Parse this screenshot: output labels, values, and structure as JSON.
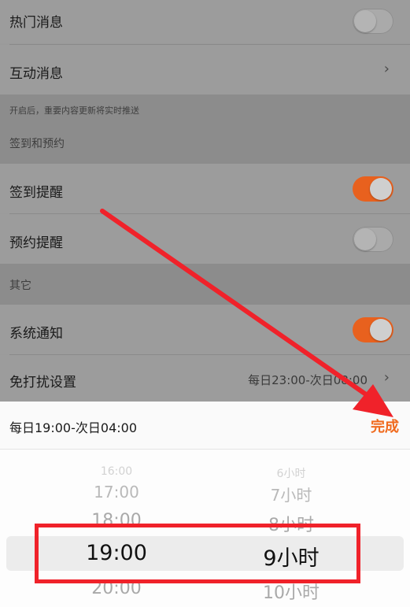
{
  "rows": {
    "hot_news": {
      "label": "热门消息",
      "toggle": "off"
    },
    "interactive": {
      "label": "互动消息",
      "chevron": "chevron-right-icon"
    },
    "hint": "开启后，重要内容更新将实时推送",
    "section_checkin": "签到和预约",
    "checkin_reminder": {
      "label": "签到提醒",
      "toggle": "on"
    },
    "booking_reminder": {
      "label": "预约提醒",
      "toggle": "off"
    },
    "section_other": "其它",
    "system_notice": {
      "label": "系统通知",
      "toggle": "on"
    },
    "dnd": {
      "label": "免打扰设置",
      "value": "每日23:00-次日08:00"
    }
  },
  "picker_bar": {
    "range": "每日19:00-次日04:00",
    "done": "完成"
  },
  "picker": {
    "left": [
      "16:00",
      "17:00",
      "18:00",
      "19:00",
      "20:00"
    ],
    "right": [
      "6小时",
      "7小时",
      "8小时",
      "9小时",
      "10小时"
    ],
    "selected_index": 3
  },
  "colors": {
    "accent": "#f06a1d",
    "toggle_on": "#e8611e",
    "annotation": "#f0222a"
  }
}
